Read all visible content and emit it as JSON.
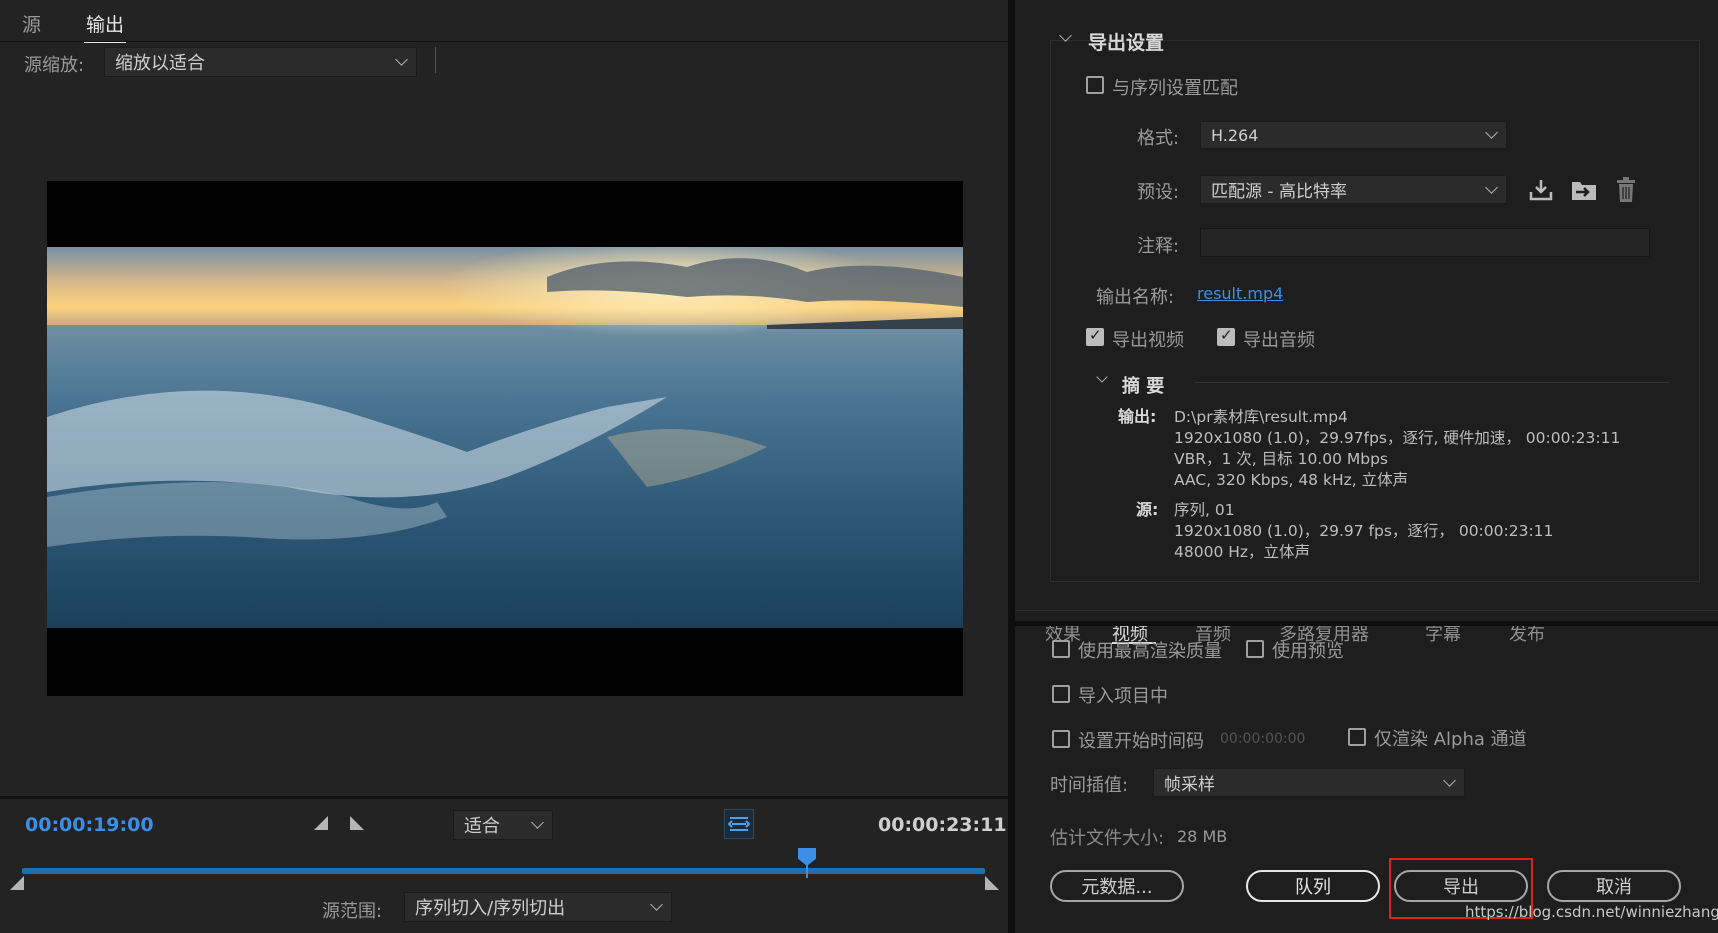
{
  "tabs": {
    "source": "源",
    "output": "输出"
  },
  "source_scale": {
    "label": "源缩放:",
    "value": "缩放以适合"
  },
  "playback": {
    "current_time": "00:00:19:00",
    "end_time": "00:00:23:11",
    "zoom_value": "适合",
    "playhead_fraction": 0.81
  },
  "source_range": {
    "label": "源范围:",
    "value": "序列切入/序列切出"
  },
  "export_settings": {
    "section_title": "导出设置",
    "match_sequence_label": "与序列设置匹配",
    "match_sequence_checked": false,
    "format_label": "格式:",
    "format_value": "H.264",
    "preset_label": "预设:",
    "preset_value": "匹配源 - 高比特率",
    "comment_label": "注释:",
    "comment_value": "",
    "output_name_label": "输出名称:",
    "output_name_value": "result.mp4",
    "export_video_label": "导出视频",
    "export_video_checked": true,
    "export_audio_label": "导出音频",
    "export_audio_checked": true
  },
  "summary": {
    "title": "摘 要",
    "output_label": "输出:",
    "output_lines": [
      "D:\\pr素材库\\result.mp4",
      "1920x1080 (1.0)，29.97fps，逐行, 硬件加速， 00:00:23:11",
      "VBR，1 次, 目标 10.00 Mbps",
      "AAC, 320 Kbps, 48  kHz, 立体声"
    ],
    "source_label": "源:",
    "source_lines": [
      "序列, 01",
      "1920x1080 (1.0)，29.97 fps，逐行， 00:00:23:11",
      "48000 Hz，立体声"
    ]
  },
  "panel_tabs": [
    "效果",
    "视频",
    "音频",
    "多路复用器",
    "字幕",
    "发布"
  ],
  "options": {
    "max_render_quality": "使用最高渲染质量",
    "use_previews": "使用预览",
    "import_into_project": "导入项目中",
    "set_start_timecode": "设置开始时间码",
    "start_timecode_value": "00:00:00:00",
    "render_alpha_only": "仅渲染 Alpha 通道",
    "time_interpolation_label": "时间插值:",
    "time_interpolation_value": "帧采样",
    "estimated_size_label": "估计文件大小:",
    "estimated_size_value": "28 MB"
  },
  "buttons": {
    "metadata": "元数据...",
    "queue": "队列",
    "export": "导出",
    "cancel": "取消"
  },
  "watermark": "https://blog.csdn.net/winniezhang",
  "colors": {
    "accent_blue": "#3b8fe6",
    "highlight_red": "#e02020"
  }
}
